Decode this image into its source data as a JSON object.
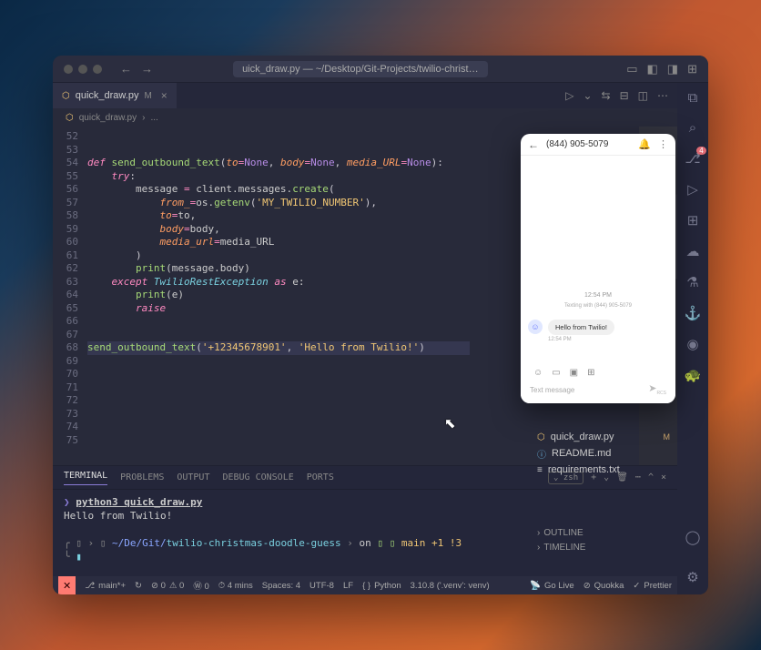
{
  "titlebar": {
    "path": "uick_draw.py — ~/Desktop/Git-Projects/twilio-christmas-doodle-g"
  },
  "tab": {
    "filename": "quick_draw.py",
    "modified": "M",
    "close": "×"
  },
  "breadcrumb": {
    "file": "quick_draw.py",
    "sep": "›",
    "more": "..."
  },
  "gutter": [
    "52",
    "53",
    "54",
    "55",
    "56",
    "57",
    "58",
    "59",
    "60",
    "61",
    "62",
    "63",
    "64",
    "65",
    "66",
    "67",
    "68",
    "69",
    "70",
    "71",
    "72",
    "73",
    "74",
    "75"
  ],
  "code": {
    "l54_def": "def ",
    "l54_fn": "send_outbound_text",
    "l54_p": "(",
    "l54_to": "to",
    "l54_eq": "=",
    "l54_none": "None",
    "l54_c": ", ",
    "l54_body": "body",
    "l54_mu": "media_URL",
    "l54_close": "):",
    "l55": "try",
    "l55_c": ":",
    "l56_a": "message ",
    "l56_eq": "= ",
    "l56_b": "client.messages.",
    "l56_create": "create",
    "l56_p": "(",
    "l57_a": "from_",
    "l57_eq": "=",
    "l57_b": "os.",
    "l57_get": "getenv",
    "l57_p": "(",
    "l57_str": "'MY_TWILIO_NUMBER'",
    "l57_cp": "),",
    "l58_a": "to",
    "l58_b": "to,",
    "l59_a": "body",
    "l59_b": "body,",
    "l60_a": "media_url",
    "l60_b": "media_URL",
    "l61": ")",
    "l62_a": "print",
    "l62_b": "(message.body)",
    "l63_a": "except ",
    "l63_b": "TwilioRestException",
    "l63_c": " as ",
    "l63_d": "e:",
    "l64_a": "print",
    "l64_b": "(e)",
    "l65": "raise",
    "l68_a": "send_outbound_text",
    "l68_p": "(",
    "l68_s1": "'+12345678901'",
    "l68_c": ", ",
    "l68_s2": "'Hello from Twilio!'",
    "l68_cp": ")"
  },
  "terminal": {
    "tabs": {
      "terminal": "TERMINAL",
      "problems": "PROBLEMS",
      "output": "OUTPUT",
      "debug": "DEBUG CONSOLE",
      "ports": "PORTS"
    },
    "shell": "zsh",
    "line1_prompt": "❯",
    "line1_cmd": "python3 quick_draw.py",
    "line2": "Hello from Twilio!",
    "pl_path": "~/De/Git/",
    "pl_proj": "twilio-christmas-doodle-guess",
    "pl_on": "on",
    "pl_branch": "main +1 !3"
  },
  "status": {
    "remote": "✕",
    "branch": "main*+",
    "sync": "↻",
    "err": "⊘ 0",
    "warn": "⚠ 0",
    "w": "Ⓦ 0",
    "time": "⏱ 4 mins",
    "spaces": "Spaces: 4",
    "enc": "UTF-8",
    "eol": "LF",
    "lang": "Python",
    "ver": "3.10.8 ('.venv': venv)",
    "golive": "Go Live",
    "quokka": "Quokka",
    "prettier": "Prettier"
  },
  "explorer": {
    "f1": "quick_draw.py",
    "f1m": "M",
    "f2": "README.md",
    "f3": "requirements.txt"
  },
  "outline": "OUTLINE",
  "timeline": "TIMELINE",
  "phone": {
    "contact": "(844) 905-5079",
    "time": "12:54 PM",
    "subtext": "Texting with (844) 905-5079",
    "msg": "Hello from Twilio!",
    "msg_time": "12:54 PM",
    "placeholder": "Text message",
    "rcs": "RCS"
  }
}
